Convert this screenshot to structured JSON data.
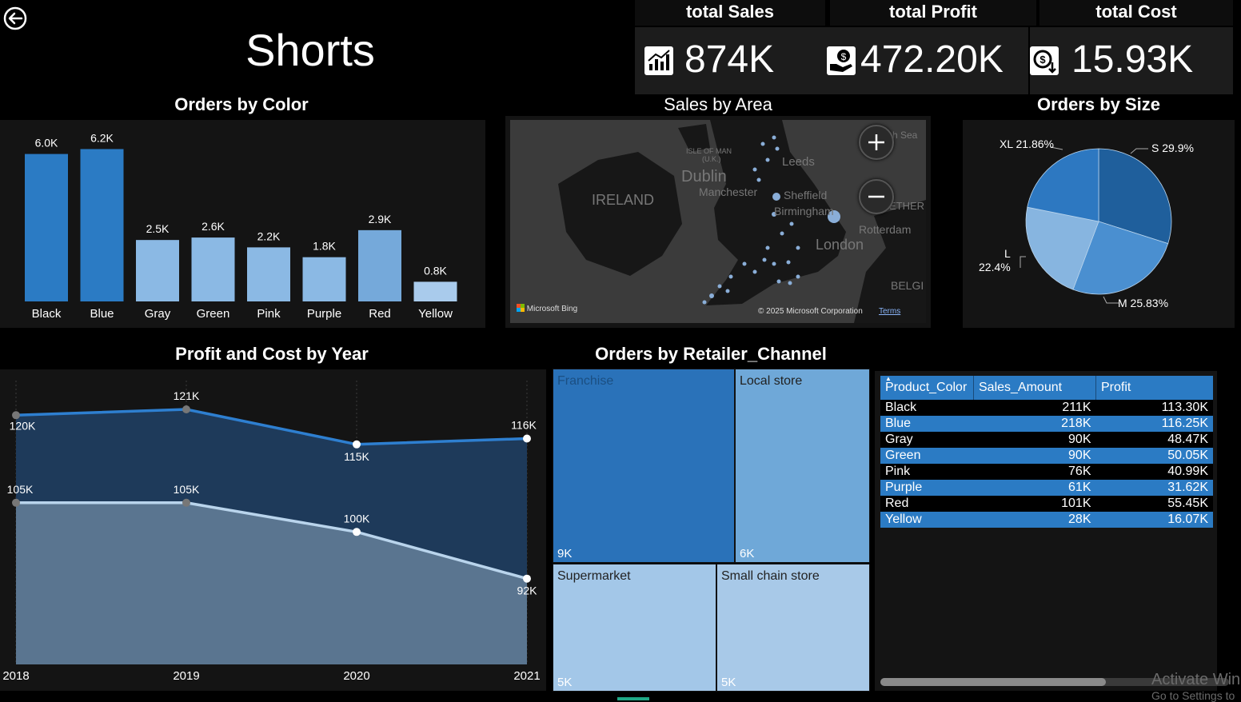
{
  "page_title": "Shorts",
  "kpis": [
    {
      "label": "total Sales",
      "value": "874K",
      "icon": "sales-chart-icon"
    },
    {
      "label": "total Profit",
      "value": "472.20K",
      "icon": "money-hand-icon"
    },
    {
      "label": "total Cost",
      "value": "15.93K",
      "icon": "coin-down-icon"
    }
  ],
  "titles": {
    "orders_by_color": "Orders by Color",
    "sales_by_area": "Sales by Area",
    "orders_by_size": "Orders by Size",
    "profit_cost": "Profit and Cost by Year",
    "retailer": "Orders by Retailer_Channel"
  },
  "map": {
    "labels": {
      "dublin": "Dublin",
      "ireland": "IRELAND",
      "leeds": "Leeds",
      "manchester": "Manchester",
      "sheffield": "Sheffield",
      "birmingham": "Birmingham",
      "london": "London",
      "rotterdam": "Rotterdam",
      "isle_of_man": "ISLE OF MAN",
      "uk": "(U.K.)",
      "north_sea": "h Sea",
      "nether": "ETHER",
      "belgi": "BELGI"
    },
    "bing": "Microsoft Bing",
    "copyright": "© 2025 Microsoft Corporation",
    "terms": "Terms"
  },
  "table": {
    "headers": [
      "Product_Color",
      "Sales_Amount",
      "Profit"
    ],
    "rows": [
      [
        "Black",
        "211K",
        "113.30K"
      ],
      [
        "Blue",
        "218K",
        "116.25K"
      ],
      [
        "Gray",
        "90K",
        "48.47K"
      ],
      [
        "Green",
        "90K",
        "50.05K"
      ],
      [
        "Pink",
        "76K",
        "40.99K"
      ],
      [
        "Purple",
        "61K",
        "31.62K"
      ],
      [
        "Red",
        "101K",
        "55.45K"
      ],
      [
        "Yellow",
        "28K",
        "16.07K"
      ]
    ]
  },
  "treemap": [
    {
      "label": "Franchise",
      "value": "9K",
      "color": "#2a72b9"
    },
    {
      "label": "Local store",
      "value": "6K",
      "color": "#6fa8d8"
    },
    {
      "label": "Supermarket",
      "value": "5K",
      "color": "#a3c7e8"
    },
    {
      "label": "Small chain store",
      "value": "5K",
      "color": "#a8c9e8"
    }
  ],
  "watermark": {
    "line1": "Activate Win",
    "line2": "Go to Settings to"
  },
  "chart_data": [
    {
      "type": "bar",
      "title": "Orders by Color",
      "categories": [
        "Black",
        "Blue",
        "Gray",
        "Green",
        "Pink",
        "Purple",
        "Red",
        "Yellow"
      ],
      "values": [
        6.0,
        6.2,
        2.5,
        2.6,
        2.2,
        1.8,
        2.9,
        0.8
      ],
      "labels": [
        "6.0K",
        "6.2K",
        "2.5K",
        "2.6K",
        "2.2K",
        "1.8K",
        "2.9K",
        "0.8K"
      ],
      "colors": [
        "#2b7bc4",
        "#2b7bc4",
        "#8bb9e4",
        "#8bb9e4",
        "#8bb9e4",
        "#8bb9e4",
        "#75a9da",
        "#a9cbec"
      ],
      "ylim": [
        0,
        6.8
      ]
    },
    {
      "type": "pie",
      "title": "Orders by Size",
      "slices": [
        {
          "label": "S",
          "pct": 29.9,
          "color": "#1f5f9c"
        },
        {
          "label": "M",
          "pct": 25.83,
          "color": "#4a8fd0"
        },
        {
          "label": "L",
          "pct": 22.4,
          "color": "#87b5e0"
        },
        {
          "label": "XL",
          "pct": 21.86,
          "color": "#2d78c1"
        }
      ],
      "slice_labels": [
        "S 29.9%",
        "M 25.83%",
        "22.4%",
        "XL 21.86%"
      ],
      "slice_label_L": "L"
    },
    {
      "type": "area",
      "title": "Profit and Cost by Year",
      "x": [
        "2018",
        "2019",
        "2020",
        "2021"
      ],
      "series": [
        {
          "values": [
            120,
            121,
            115,
            116
          ],
          "labels": [
            "120K",
            "121K",
            "115K",
            "116K"
          ],
          "color": "#2e7fd0"
        },
        {
          "values": [
            105,
            105,
            100,
            92
          ],
          "labels": [
            "105K",
            "105K",
            "100K",
            "92K"
          ],
          "color": "#b9d4ec"
        }
      ],
      "ylim": [
        80,
        125
      ]
    }
  ]
}
